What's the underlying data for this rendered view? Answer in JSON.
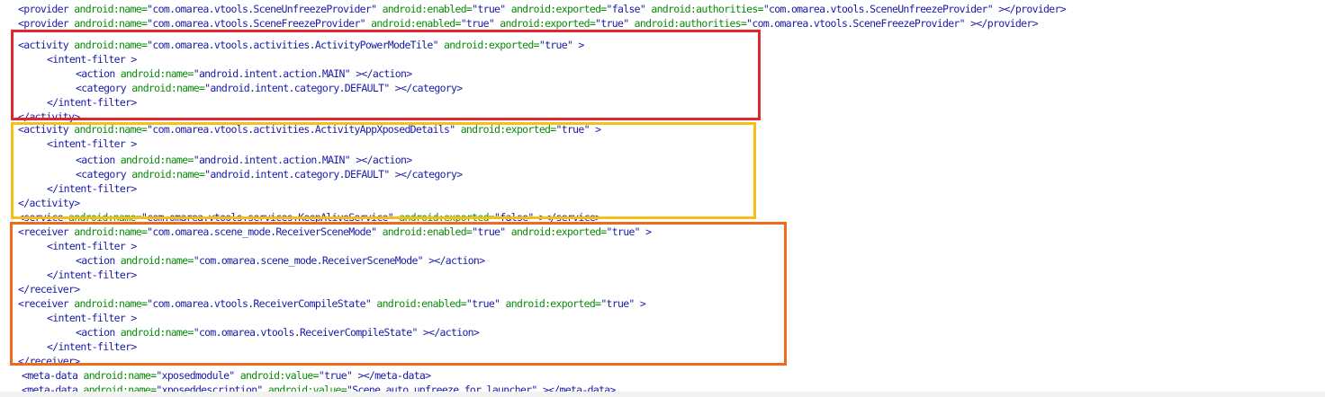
{
  "colors": {
    "tag": "#1a1aa6",
    "attr": "#0a8a0a",
    "value": "#1a1aa6",
    "highlight_red": "#e0262a",
    "highlight_yellow": "#f5bf1a",
    "highlight_orange": "#f06a1c"
  },
  "highlights": [
    {
      "name": "highlight-box-red",
      "color": "#e0262a"
    },
    {
      "name": "highlight-box-yellow",
      "color": "#f5bf1a"
    },
    {
      "name": "highlight-box-orange",
      "color": "#f06a1c"
    }
  ],
  "lines": [
    [
      [
        "t",
        "<provider "
      ],
      [
        "a",
        "android:name="
      ],
      [
        "v",
        "\"com.omarea.vtools.SceneUnfreezeProvider\" "
      ],
      [
        "a",
        "android:enabled="
      ],
      [
        "v",
        "\"true\" "
      ],
      [
        "a",
        "android:exported="
      ],
      [
        "v",
        "\"false\" "
      ],
      [
        "a",
        "android:authorities="
      ],
      [
        "v",
        "\"com.omarea.vtools.SceneUnfreezeProvider\" "
      ],
      [
        "t",
        "></provider>"
      ]
    ],
    [
      [
        "t",
        "<provider "
      ],
      [
        "a",
        "android:name="
      ],
      [
        "v",
        "\"com.omarea.vtools.SceneFreezeProvider\" "
      ],
      [
        "a",
        "android:enabled="
      ],
      [
        "v",
        "\"true\" "
      ],
      [
        "a",
        "android:exported="
      ],
      [
        "v",
        "\"true\" "
      ],
      [
        "a",
        "android:authorities="
      ],
      [
        "v",
        "\"com.omarea.vtools.SceneFreezeProvider\" "
      ],
      [
        "t",
        "></provider>"
      ]
    ],
    [
      [
        "t",
        "<activity "
      ],
      [
        "a",
        "android:name="
      ],
      [
        "v",
        "\"com.omarea.vtools.activities.ActivityPowerModeTile\" "
      ],
      [
        "a",
        "android:exported="
      ],
      [
        "v",
        "\"true\" "
      ],
      [
        "t",
        ">"
      ]
    ],
    [
      [
        "t",
        "<intent-filter >"
      ]
    ],
    [
      [
        "t",
        "<action "
      ],
      [
        "a",
        "android:name="
      ],
      [
        "v",
        "\"android.intent.action.MAIN\" "
      ],
      [
        "t",
        "></action>"
      ]
    ],
    [
      [
        "t",
        "<category "
      ],
      [
        "a",
        "android:name="
      ],
      [
        "v",
        "\"android.intent.category.DEFAULT\" "
      ],
      [
        "t",
        "></category>"
      ]
    ],
    [
      [
        "t",
        "</intent-filter>"
      ]
    ],
    [
      [
        "t",
        "</activity>"
      ]
    ],
    [
      [
        "t",
        "<activity "
      ],
      [
        "a",
        "android:name="
      ],
      [
        "v",
        "\"com.omarea.vtools.activities.ActivityAppXposedDetails\" "
      ],
      [
        "a",
        "android:exported="
      ],
      [
        "v",
        "\"true\" "
      ],
      [
        "t",
        ">"
      ]
    ],
    [
      [
        "t",
        "<intent-filter >"
      ]
    ],
    [
      [
        "t",
        "<action "
      ],
      [
        "a",
        "android:name="
      ],
      [
        "v",
        "\"android.intent.action.MAIN\" "
      ],
      [
        "t",
        "></action>"
      ]
    ],
    [
      [
        "t",
        "<category "
      ],
      [
        "a",
        "android:name="
      ],
      [
        "v",
        "\"android.intent.category.DEFAULT\" "
      ],
      [
        "t",
        "></category>"
      ]
    ],
    [
      [
        "t",
        "</intent-filter>"
      ]
    ],
    [
      [
        "t",
        "</activity>"
      ]
    ],
    [
      [
        "t",
        "<service "
      ],
      [
        "a",
        "android:name="
      ],
      [
        "v",
        "\"com.omarea.vtools.services.KeepAliveService\" "
      ],
      [
        "a",
        "android:exported="
      ],
      [
        "v",
        "\"false\" "
      ],
      [
        "t",
        "></service>"
      ]
    ],
    [
      [
        "t",
        "<receiver "
      ],
      [
        "a",
        "android:name="
      ],
      [
        "v",
        "\"com.omarea.scene_mode.ReceiverSceneMode\" "
      ],
      [
        "a",
        "android:enabled="
      ],
      [
        "v",
        "\"true\" "
      ],
      [
        "a",
        "android:exported="
      ],
      [
        "v",
        "\"true\" "
      ],
      [
        "t",
        ">"
      ]
    ],
    [
      [
        "t",
        "<intent-filter >"
      ]
    ],
    [
      [
        "t",
        "<action "
      ],
      [
        "a",
        "android:name="
      ],
      [
        "v",
        "\"com.omarea.scene_mode.ReceiverSceneMode\" "
      ],
      [
        "t",
        "></action>"
      ]
    ],
    [
      [
        "t",
        "</intent-filter>"
      ]
    ],
    [
      [
        "t",
        "</receiver>"
      ]
    ],
    [
      [
        "t",
        "<receiver "
      ],
      [
        "a",
        "android:name="
      ],
      [
        "v",
        "\"com.omarea.vtools.ReceiverCompileState\" "
      ],
      [
        "a",
        "android:enabled="
      ],
      [
        "v",
        "\"true\" "
      ],
      [
        "a",
        "android:exported="
      ],
      [
        "v",
        "\"true\" "
      ],
      [
        "t",
        ">"
      ]
    ],
    [
      [
        "t",
        "<intent-filter >"
      ]
    ],
    [
      [
        "t",
        "<action "
      ],
      [
        "a",
        "android:name="
      ],
      [
        "v",
        "\"com.omarea.vtools.ReceiverCompileState\" "
      ],
      [
        "t",
        "></action>"
      ]
    ],
    [
      [
        "t",
        "</intent-filter>"
      ]
    ],
    [
      [
        "t",
        "</receiver>"
      ]
    ],
    [
      [
        "t",
        "<meta-data "
      ],
      [
        "a",
        "android:name="
      ],
      [
        "v",
        "\"xposedmodule\" "
      ],
      [
        "a",
        "android:value="
      ],
      [
        "v",
        "\"true\" "
      ],
      [
        "t",
        "></meta-data>"
      ]
    ],
    [
      [
        "t",
        "<meta-data "
      ],
      [
        "a",
        "android:name="
      ],
      [
        "v",
        "\"xposeddescription\" "
      ],
      [
        "a",
        "android:value="
      ],
      [
        "v",
        "\"Scene auto unfreeze for launcher\" "
      ],
      [
        "t",
        "></meta-data>"
      ]
    ]
  ]
}
